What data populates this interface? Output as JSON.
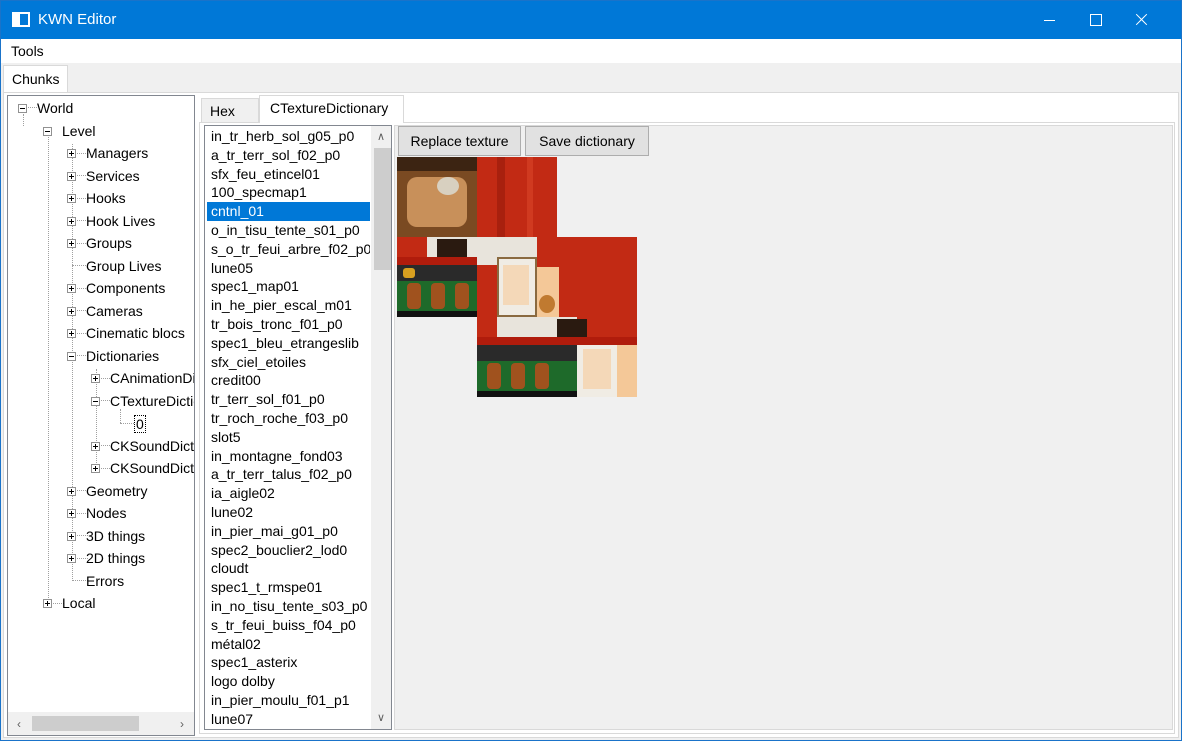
{
  "window": {
    "title": "KWN Editor"
  },
  "menu": {
    "tools": "Tools"
  },
  "outer_tabs": {
    "chunks": "Chunks"
  },
  "tree": {
    "world": "World",
    "level": "Level",
    "managers": "Managers",
    "services": "Services",
    "hooks": "Hooks",
    "hook_lives": "Hook Lives",
    "groups": "Groups",
    "group_lives": "Group Lives",
    "components": "Components",
    "cameras": "Cameras",
    "cinematic_blocs": "Cinematic blocs",
    "dictionaries": "Dictionaries",
    "canimation": "CAnimationDictionary",
    "ctexture": "CTextureDictionary",
    "zero": "0",
    "cksound1": "CKSoundDictionary",
    "cksound2": "CKSoundDictionary",
    "geometry": "Geometry",
    "nodes": "Nodes",
    "things3d": "3D things",
    "things2d": "2D things",
    "errors": "Errors",
    "local": "Local"
  },
  "inner_tabs": {
    "hex": "Hex",
    "ctexture": "CTextureDictionary"
  },
  "buttons": {
    "replace": "Replace texture",
    "save": "Save dictionary"
  },
  "textures": [
    "in_tr_herb_sol_g05_p0",
    "a_tr_terr_sol_f02_p0",
    "sfx_feu_etincel01",
    "100_specmap1",
    "cntnl_01",
    "o_in_tisu_tente_s01_p0",
    "s_o_tr_feui_arbre_f02_p0",
    "lune05",
    "spec1_map01",
    "in_he_pier_escal_m01",
    "tr_bois_tronc_f01_p0",
    "spec1_bleu_etrangeslib",
    "sfx_ciel_etoiles",
    "credit00",
    "tr_terr_sol_f01_p0",
    "tr_roch_roche_f03_p0",
    "slot5",
    "in_montagne_fond03",
    "a_tr_terr_talus_f02_p0",
    "ia_aigle02",
    "lune02",
    "in_pier_mai_g01_p0",
    "spec2_bouclier2_lod0",
    "cloudt",
    "spec1_t_rmspe01",
    "in_no_tisu_tente_s03_p0",
    "s_tr_feui_buiss_f04_p0",
    "métal02",
    "spec1_asterix",
    "logo dolby",
    "in_pier_moulu_f01_p1",
    "lune07"
  ],
  "selected_texture_index": 4
}
